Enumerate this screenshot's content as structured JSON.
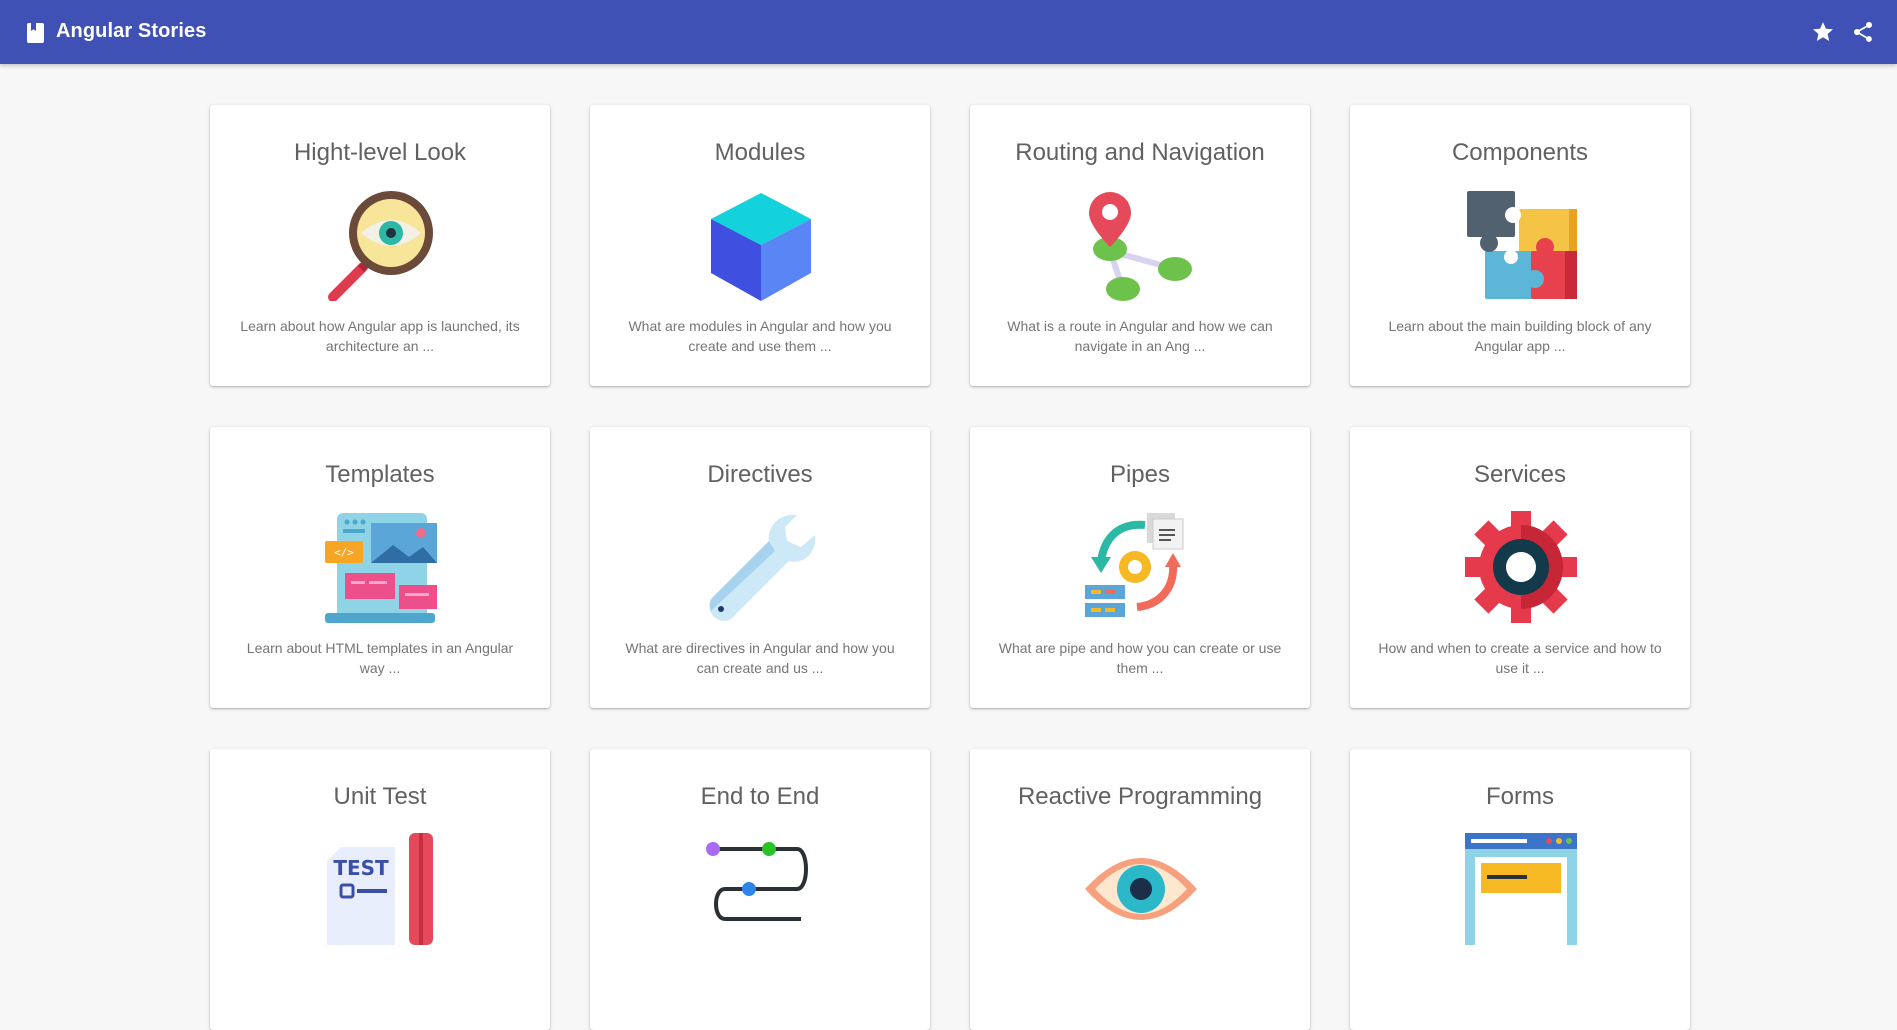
{
  "header": {
    "title": "Angular Stories",
    "actions": [
      {
        "icon": "star-icon",
        "label": "star"
      },
      {
        "icon": "share-icon",
        "label": "share"
      }
    ]
  },
  "cards": [
    {
      "title": "Hight-level Look",
      "description": "Learn about how Angular app is launched, its architecture an ...",
      "icon": "magnifier-eye-icon"
    },
    {
      "title": "Modules",
      "description": "What are modules in Angular and how you create and use them ...",
      "icon": "cube-icon"
    },
    {
      "title": "Routing and Navigation",
      "description": "What is a route in Angular and how we can navigate in an Ang ...",
      "icon": "route-pin-icon"
    },
    {
      "title": "Components",
      "description": "Learn about the main building block of any Angular app ...",
      "icon": "puzzle-icon"
    },
    {
      "title": "Templates",
      "description": "Learn about HTML templates in an Angular way ...",
      "icon": "template-layout-icon"
    },
    {
      "title": "Directives",
      "description": "What are directives in Angular and how you can create and us ...",
      "icon": "wrench-icon"
    },
    {
      "title": "Pipes",
      "description": "What are pipe and how you can create or use them ...",
      "icon": "pipe-process-icon"
    },
    {
      "title": "Services",
      "description": "How and when to create a service and how to use it ...",
      "icon": "gear-icon"
    },
    {
      "title": "Unit Test",
      "description": "",
      "icon": "test-sheet-icon"
    },
    {
      "title": "End to End",
      "description": "",
      "icon": "flow-path-icon"
    },
    {
      "title": "Reactive Programming",
      "description": "",
      "icon": "eye-icon"
    },
    {
      "title": "Forms",
      "description": "",
      "icon": "form-window-icon"
    }
  ],
  "colors": {
    "toolbar": "#3f51b5",
    "background": "#f7f7f7",
    "card": "#ffffff",
    "title_text": "#616161",
    "desc_text": "#757575"
  }
}
